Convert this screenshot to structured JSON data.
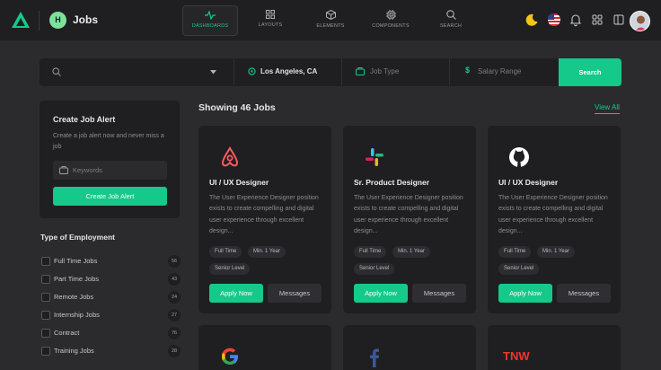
{
  "app": {
    "title": "Jobs",
    "badge": "H"
  },
  "nav": [
    {
      "label": "DASHBOARDS",
      "icon": "pulse-icon",
      "active": true
    },
    {
      "label": "LAYOUTS",
      "icon": "grid-icon",
      "active": false
    },
    {
      "label": "ELEMENTS",
      "icon": "cube-icon",
      "active": false
    },
    {
      "label": "COMPONENTS",
      "icon": "chip-icon",
      "active": false
    },
    {
      "label": "SEARCH",
      "icon": "search-icon",
      "active": false
    }
  ],
  "toolbar": {
    "icons": [
      "moon-icon",
      "us-flag-icon",
      "bell-icon",
      "apps-icon",
      "sidebar-icon",
      "user-avatar"
    ]
  },
  "search": {
    "keyword_placeholder": "",
    "location": "Los Angeles, CA",
    "job_type_placeholder": "Job Type",
    "salary_placeholder": "Salary Range",
    "button_label": "Search"
  },
  "alert": {
    "title": "Create Job Alert",
    "description": "Create a job alert now and never miss a job",
    "keywords_placeholder": "Keywords",
    "button_label": "Create Job Alert"
  },
  "employment": {
    "title": "Type of Employment",
    "items": [
      {
        "label": "Full Time Jobs",
        "count": "56"
      },
      {
        "label": "Part Time Jobs",
        "count": "43"
      },
      {
        "label": "Remote Jobs",
        "count": "24"
      },
      {
        "label": "Internship Jobs",
        "count": "27"
      },
      {
        "label": "Contract",
        "count": "76"
      },
      {
        "label": "Training Jobs",
        "count": "28"
      }
    ]
  },
  "jobs_header": {
    "showing": "Showing 46 Jobs",
    "view_all": "View All"
  },
  "jobs": [
    {
      "company_icon": "airbnb-logo-icon",
      "title": "UI / UX Designer",
      "description": "The User Experience Designer position exists to create compelling and digital user experience through excellent design...",
      "tags": [
        "Full Time",
        "Min. 1 Year",
        "Senior Level"
      ],
      "apply_label": "Apply Now",
      "message_label": "Messages"
    },
    {
      "company_icon": "slack-logo-icon",
      "title": "Sr. Product Designer",
      "description": "The User Experience Designer position exists to create compelling and digital user experience through excellent design...",
      "tags": [
        "Full Time",
        "Min. 1 Year",
        "Senior Level"
      ],
      "apply_label": "Apply Now",
      "message_label": "Messages"
    },
    {
      "company_icon": "github-logo-icon",
      "title": "UI / UX Designer",
      "description": "The User Experience Designer position exists to create compelling and digital user experience through excellent design...",
      "tags": [
        "Full Time",
        "Min. 1 Year",
        "Senior Level"
      ],
      "apply_label": "Apply Now",
      "message_label": "Messages"
    }
  ],
  "more_jobs": [
    {
      "company_icon": "google-logo-icon"
    },
    {
      "company_icon": "facebook-logo-icon"
    },
    {
      "company_icon": "tnw-logo-icon",
      "logo_text": "TNW"
    }
  ],
  "colors": {
    "accent": "#15c98a",
    "background": "#2b2b2e",
    "card": "#1f1f22"
  }
}
